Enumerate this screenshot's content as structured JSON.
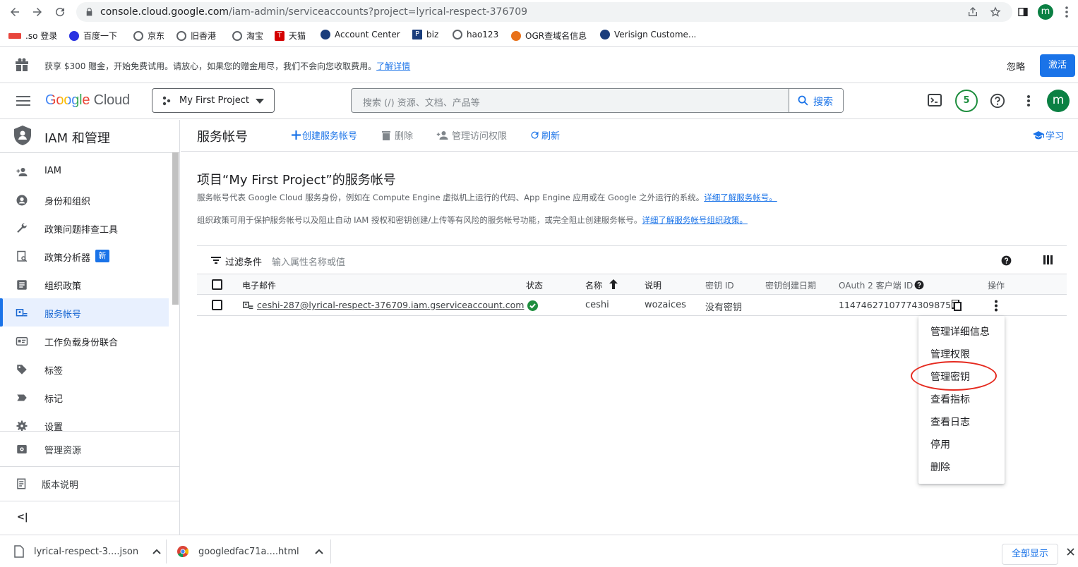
{
  "browser": {
    "url_host": "console.cloud.google.com",
    "url_path": "/iam-admin/serviceaccounts?project=lyrical-respect-376709",
    "profile_initial": "m"
  },
  "bookmarks": [
    {
      "label": ".so 登录",
      "color": "#e8453c"
    },
    {
      "label": "百度一下",
      "color": "#2932e1"
    },
    {
      "label": "京东",
      "color": "#5f6368"
    },
    {
      "label": "旧香港",
      "color": "#5f6368"
    },
    {
      "label": "淘宝",
      "color": "#5f6368"
    },
    {
      "label": "天猫",
      "color": "#d40000"
    },
    {
      "label": "Account Center",
      "color": "#1a3d7c"
    },
    {
      "label": "biz",
      "color": "#1a3d7c"
    },
    {
      "label": "hao123",
      "color": "#5f6368"
    },
    {
      "label": "OGR查域名信息",
      "color": "#e8711a"
    },
    {
      "label": "Verisign Custome...",
      "color": "#1a3d7c"
    }
  ],
  "banner": {
    "text": "获享 $300 赠金，开始免费试用。请放心，如果您的赠金用尽，我们不会向您收取费用。",
    "link": "了解详情",
    "dismiss": "忽略",
    "activate": "激活"
  },
  "header": {
    "logo_google": "Google",
    "logo_cloud": "Cloud",
    "project": "My First Project",
    "search_placeholder": "搜索 (/) 资源、文档、产品等",
    "search_button": "搜索",
    "notifications_count": "5",
    "avatar_initial": "m"
  },
  "sidebar": {
    "title": "IAM 和管理",
    "items": [
      {
        "label": "IAM",
        "icon": "person-add-icon"
      },
      {
        "label": "身份和组织",
        "icon": "account-circle-icon"
      },
      {
        "label": "政策问题排查工具",
        "icon": "wrench-icon"
      },
      {
        "label": "政策分析器",
        "icon": "policy-analyzer-icon"
      },
      {
        "label": "组织政策",
        "icon": "list-icon"
      },
      {
        "label": "服务帐号",
        "icon": "service-account-icon"
      },
      {
        "label": "工作负载身份联合",
        "icon": "id-card-icon"
      },
      {
        "label": "标签",
        "icon": "tag-icon"
      },
      {
        "label": "标记",
        "icon": "label-icon"
      },
      {
        "label": "设置",
        "icon": "gear-icon"
      }
    ],
    "new_badge": "新",
    "manage_resources": "管理资源",
    "release_notes": "版本说明",
    "collapse": "<|"
  },
  "toolbar": {
    "title": "服务帐号",
    "create": "创建服务帐号",
    "delete": "删除",
    "manage_access": "管理访问权限",
    "refresh": "刷新",
    "learn": "学习"
  },
  "content": {
    "heading": "项目“My First Project”的服务帐号",
    "desc1": "服务帐号代表 Google Cloud 服务身份，例如在 Compute Engine 虚拟机上运行的代码、App Engine 应用或在 Google 之外运行的系统。",
    "desc1_link": "详细了解服务帐号。",
    "desc2": "组织政策可用于保护服务帐号以及阻止自动 IAM 授权和密钥创建/上传等有风险的服务帐号功能，或完全阻止创建服务帐号。",
    "desc2_link": "详细了解服务帐号组织政策。"
  },
  "filter": {
    "label": "过滤条件",
    "placeholder": "输入属性名称或值"
  },
  "table": {
    "columns": [
      "电子邮件",
      "状态",
      "名称",
      "说明",
      "密钥 ID",
      "密钥创建日期",
      "OAuth 2 客户端 ID",
      "操作"
    ],
    "rows": [
      {
        "email": "ceshi-287@lyrical-respect-376709.iam.gserviceaccount.com",
        "status": "enabled",
        "name": "ceshi",
        "description": "wozaices",
        "key_id": "没有密钥",
        "key_created": "",
        "oauth_client_id": "114746271077743098751"
      }
    ]
  },
  "context_menu": [
    "管理详细信息",
    "管理权限",
    "管理密钥",
    "查看指标",
    "查看日志",
    "停用",
    "删除"
  ],
  "downloads": {
    "items": [
      "lyrical-respect-3....json",
      "googledfac71a....html"
    ],
    "show_all": "全部显示"
  },
  "colors": {
    "accent": "#1a73e8",
    "highlight_ring": "#e52a1f",
    "status_ok": "#1e8e3e"
  }
}
